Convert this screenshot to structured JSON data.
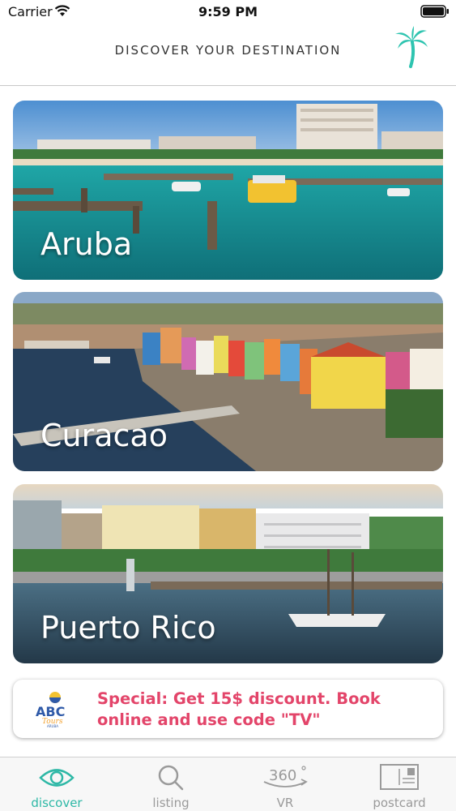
{
  "status_bar": {
    "carrier": "Carrier",
    "time": "9:59 PM"
  },
  "header": {
    "title": "DISCOVER YOUR DESTINATION",
    "logo_icon": "palm-tree-icon"
  },
  "destinations": [
    {
      "name": "Aruba"
    },
    {
      "name": "Curacao"
    },
    {
      "name": "Puerto Rico"
    }
  ],
  "promo": {
    "text": "Special: Get 15$ discount. Book online and use code \"TV\"",
    "logo_icon": "abc-tours-logo"
  },
  "tabs": [
    {
      "label": "discover",
      "icon": "eye-icon",
      "active": true
    },
    {
      "label": "listing",
      "icon": "search-icon",
      "active": false
    },
    {
      "label": "VR",
      "icon": "360-icon",
      "active": false
    },
    {
      "label": "postcard",
      "icon": "postcard-icon",
      "active": false
    }
  ],
  "colors": {
    "accent": "#2eb8a6",
    "promo_text": "#e3456a",
    "tab_inactive": "#9a9a9a"
  }
}
